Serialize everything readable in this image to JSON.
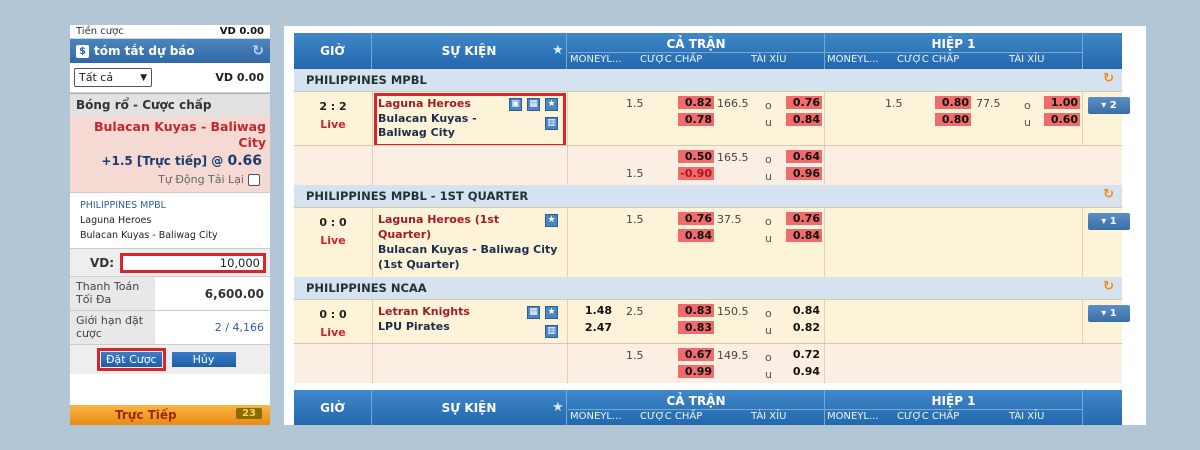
{
  "left_panel": {
    "stake_label": "Tiền cược",
    "stake_value": "VD 0.00",
    "summary_title": "tóm tắt dự báo",
    "filter_selected": "Tất cả",
    "filter_amount": "VD 0.00",
    "slip_title": "Bóng rổ - Cược chấp",
    "slip_event": "Bulacan Kuyas - Baliwag City",
    "slip_odds_prefix": "+1.5 [Trực tiếp] @",
    "slip_odds_value": "0.66",
    "auto_reload_label": "Tự Động Tải Lại",
    "league": "PHILIPPINES MPBL",
    "home": "Laguna Heroes",
    "matchup": "Bulacan Kuyas - Baliwag City",
    "vd_label": "VD:",
    "vd_value": "10,000",
    "max_pay_label": "Thanh Toán Tối Đa",
    "max_pay_value": "6,600.00",
    "limit_label": "Giới hạn đặt cược",
    "limit_value": "2 / 4,166",
    "place_bet": "Đặt Cược",
    "cancel": "Hủy",
    "live_tab": "Trực Tiếp",
    "live_count": "23"
  },
  "grid": {
    "col_time": "GIỜ",
    "col_event": "SỰ KIỆN",
    "full_match": "CẢ TRẬN",
    "half1": "HIỆP 1",
    "sub_moneyline": "MONEYL...",
    "sub_handicap": "CƯỢC CHẤP",
    "sub_ou": "TÀI XỈU"
  },
  "leagues": [
    {
      "name": "PHILIPPINES MPBL",
      "score": "2 : 2",
      "status": "Live",
      "team_home": "Laguna Heroes",
      "team_away": "Bulacan Kuyas - Baliwag City",
      "hdp_line": "1.5",
      "hdp_odd1": "0.82",
      "hdp_odd2": "0.78",
      "ou_line": "166.5",
      "ou_o": "o",
      "ou_u": "u",
      "ou_odd1": "0.76",
      "ou_odd2": "0.84",
      "h1_hdp_line": "1.5",
      "h1_hdp_odd1": "0.80",
      "h1_hdp_odd2": "0.80",
      "h1_ou_line": "77.5",
      "h1_ou_odd1": "1.00",
      "h1_ou_odd2": "0.60",
      "more": "▾ 2",
      "alt_hdp_line": "1.5",
      "alt_hdp_odd1": "0.50",
      "alt_hdp_odd2": "-0.90",
      "alt_ou_line": "165.5",
      "alt_ou_odd1": "0.64",
      "alt_ou_odd2": "0.96"
    },
    {
      "name": "PHILIPPINES MPBL - 1ST QUARTER",
      "score": "0 : 0",
      "status": "Live",
      "team_home": "Laguna Heroes (1st Quarter)",
      "team_away": "Bulacan Kuyas - Baliwag City (1st Quarter)",
      "hdp_line": "1.5",
      "hdp_odd1": "0.76",
      "hdp_odd2": "0.84",
      "ou_line": "37.5",
      "ou_o": "o",
      "ou_u": "u",
      "ou_odd1": "0.76",
      "ou_odd2": "0.84",
      "more": "▾ 1"
    },
    {
      "name": "PHILIPPINES NCAA",
      "score": "0 : 0",
      "status": "Live",
      "team_home": "Letran Knights",
      "team_away": "LPU Pirates",
      "ml1": "1.48",
      "ml2": "2.47",
      "hdp_line": "2.5",
      "hdp_odd1": "0.83",
      "hdp_odd2": "0.83",
      "ou_line": "150.5",
      "ou_o": "o",
      "ou_u": "u",
      "ou_odd1": "0.84",
      "ou_odd2": "0.82",
      "more": "▾ 1",
      "alt_hdp_line": "1.5",
      "alt_hdp_odd1": "0.67",
      "alt_hdp_odd2": "0.99",
      "alt_ou_line": "149.5",
      "alt_ou_odd1": "0.72",
      "alt_ou_odd2": "0.94"
    }
  ],
  "icons": {
    "summary": "$",
    "refresh": "↻",
    "star": "★",
    "tv": "▣",
    "stats": "▦",
    "chart": "▥"
  },
  "colors": {
    "accent_blue": "#2f68a4",
    "highlight_red": "#d9242e",
    "odds_red_bg": "#f06b6b",
    "live_orange": "#ea8b13"
  }
}
